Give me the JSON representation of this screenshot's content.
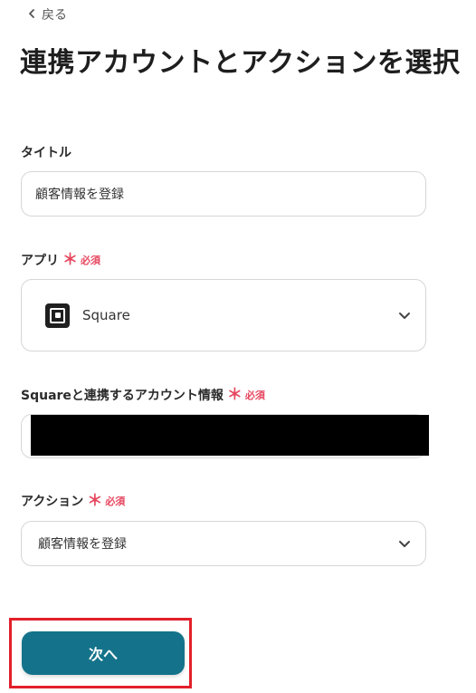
{
  "nav": {
    "back_label": "戻る"
  },
  "page": {
    "title": "連携アカウントとアクションを選択"
  },
  "fields": {
    "title": {
      "label": "タイトル",
      "value": "顧客情報を登録"
    },
    "app": {
      "label": "アプリ",
      "required_label": "必須",
      "selected": "Square",
      "icon": "square-logo-icon"
    },
    "account": {
      "label": "Squareと連携するアカウント情報",
      "required_label": "必須",
      "redacted": true
    },
    "action": {
      "label": "アクション",
      "required_label": "必須",
      "selected": "顧客情報を登録"
    }
  },
  "buttons": {
    "next_label": "次へ"
  },
  "colors": {
    "primary": "#14738a",
    "required": "#e6475f",
    "highlight": "#e2202a"
  }
}
